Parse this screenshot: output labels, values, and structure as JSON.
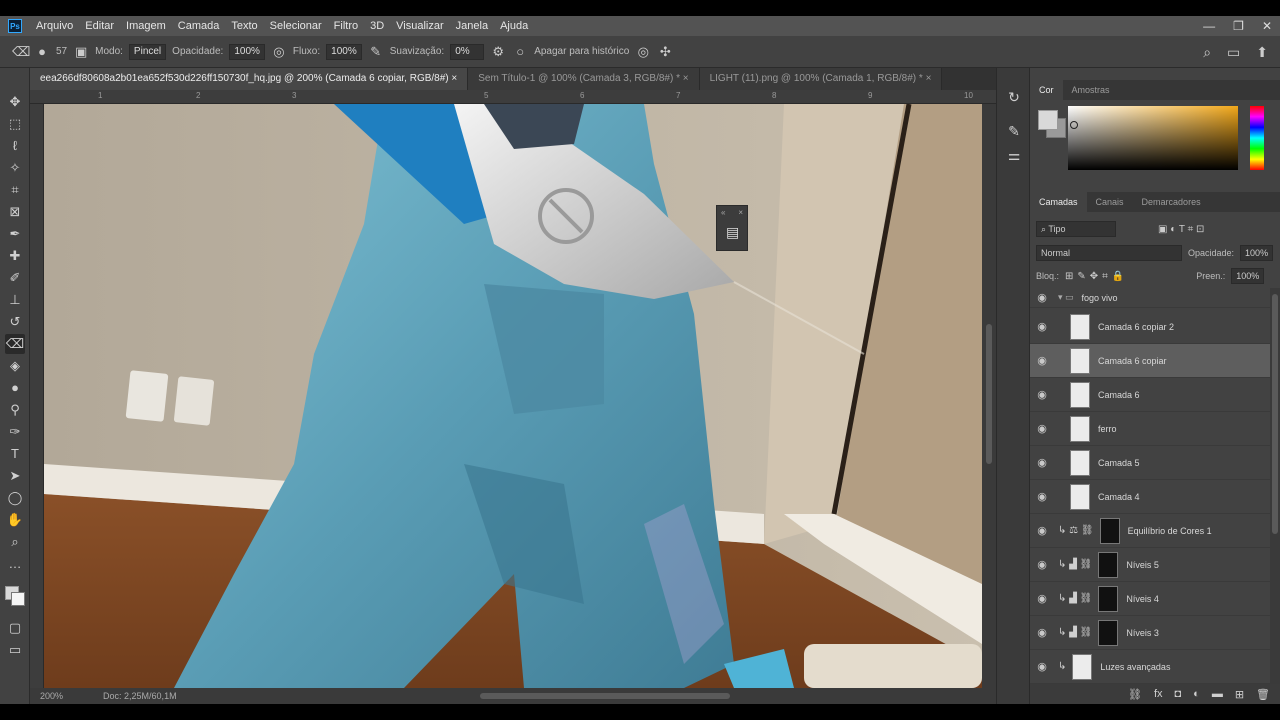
{
  "menu": {
    "items": [
      "Arquivo",
      "Editar",
      "Imagem",
      "Camada",
      "Texto",
      "Selecionar",
      "Filtro",
      "3D",
      "Visualizar",
      "Janela",
      "Ajuda"
    ],
    "logo": "Ps"
  },
  "options_bar": {
    "brush_size": "57",
    "mode_label": "Modo:",
    "mode_value": "Pincel",
    "opacity_label": "Opacidade:",
    "opacity_value": "100%",
    "flow_label": "Fluxo:",
    "flow_value": "100%",
    "smoothing_label": "Suavização:",
    "smoothing_value": "0%",
    "erase_history_label": "Apagar para histórico"
  },
  "tabs": [
    {
      "label": "eea266df80608a2b01ea652f530d226ff150730f_hq.jpg @ 200% (Camada 6 copiar, RGB/8#) ×",
      "active": true
    },
    {
      "label": "Sem Título-1 @ 100% (Camada 3, RGB/8#) * ×",
      "active": false
    },
    {
      "label": "LIGHT (11).png @ 100% (Camada 1, RGB/8#) * ×",
      "active": false
    }
  ],
  "ruler_h": [
    "1",
    "2",
    "3",
    "5",
    "6",
    "7",
    "8",
    "9",
    "10"
  ],
  "status": {
    "zoom": "200%",
    "doc": "Doc: 2,25M/60,1M"
  },
  "color_panel": {
    "tabs": [
      "Cor",
      "Amostras"
    ],
    "fg_color": "#d9d9d9",
    "bg_color": "#9a9a9a"
  },
  "layers_panel": {
    "tabs": [
      "Camadas",
      "Canais",
      "Demarcadores"
    ],
    "filter_label": "Tipo",
    "blend_mode": "Normal",
    "opacity_label": "Opacidade:",
    "opacity_value": "100%",
    "lock_label": "Bloq.:",
    "fill_label": "Preen.:",
    "fill_value": "100%",
    "layers": [
      {
        "name": "fogo vivo",
        "kind": "group",
        "selected": false
      },
      {
        "name": "Camada 6 copiar 2",
        "kind": "pixel",
        "selected": false
      },
      {
        "name": "Camada 6 copiar",
        "kind": "pixel",
        "selected": true
      },
      {
        "name": "Camada 6",
        "kind": "pixel",
        "selected": false
      },
      {
        "name": "ferro",
        "kind": "pixel",
        "selected": false
      },
      {
        "name": "Camada 5",
        "kind": "pixel",
        "selected": false
      },
      {
        "name": "Camada 4",
        "kind": "pixel",
        "selected": false
      },
      {
        "name": "Equilíbrio de Cores 1",
        "kind": "adjustment",
        "selected": false
      },
      {
        "name": "Níveis 5",
        "kind": "adjustment",
        "selected": false
      },
      {
        "name": "Níveis 4",
        "kind": "adjustment",
        "selected": false
      },
      {
        "name": "Níveis 3",
        "kind": "adjustment",
        "selected": false
      },
      {
        "name": "Luzes avançadas",
        "kind": "pixel",
        "selected": false
      }
    ]
  }
}
